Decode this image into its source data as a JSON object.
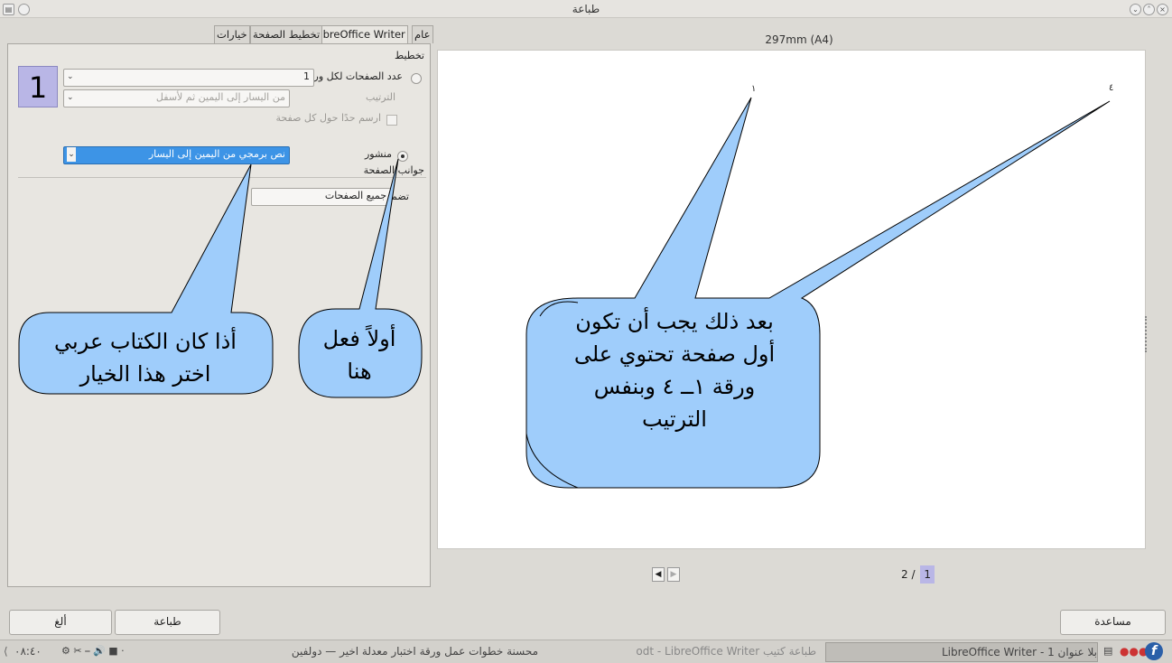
{
  "window": {
    "title": "طباعة"
  },
  "tabs": [
    "عام",
    "LibreOffice Writer",
    "تخطيط الصفحة",
    "خيارات"
  ],
  "layout": {
    "section_label": "تخطيط",
    "pages_per_sheet_label": "عدد الصفحات لكل ورقة",
    "pages_per_sheet_value": "1",
    "order_label": "الترتيب",
    "order_value": "من اليسار إلى اليمين ثم لأسفل",
    "draw_border_label": "ارسم حدًا حول كل صفحة",
    "brochure_label": "منشور",
    "brochure_value": "نص برمجي من اليمين إلى اليسار",
    "sides_label": "جوانب الصفحة",
    "include_label": "تضمين",
    "include_value": "جميع الصفحات",
    "preview_number": "1"
  },
  "preview": {
    "paper_size": "297mm (A4)",
    "page_mark_1": "١",
    "page_mark_4": "٤",
    "page_total": "2 /",
    "page_current": "1"
  },
  "buttons": {
    "cancel": "ألغ",
    "print": "طباعة",
    "help": "مساعدة"
  },
  "annotations": {
    "arabic_book_line1": "أذا كان الكتاب عربي",
    "arabic_book_line2": "اختر هذا الخيار",
    "first_do_line1": "أولاً فعل",
    "first_do_line2": "هنا",
    "after_line1": "بعد ذلك يجب أن تكون",
    "after_line2": "أول صفحة تحتوي على",
    "after_line3": "ورقة  ١ــ ٤  وبنفس",
    "after_line4": "الترتيب"
  },
  "taskbar": {
    "clock": "٠٨:٤٠",
    "task1": "بلا عنوان 1 - LibreOffice Writer",
    "task2": "طباعة كتيب odt - LibreOffice Writer",
    "task3": "محسنة خطوات عمل ورقة اختبار معدلة اخير — دولفين"
  },
  "colors": {
    "callout_fill": "#9fcdfb",
    "selection": "#3d94e6",
    "preview_number_bg": "#b9b6e6"
  }
}
